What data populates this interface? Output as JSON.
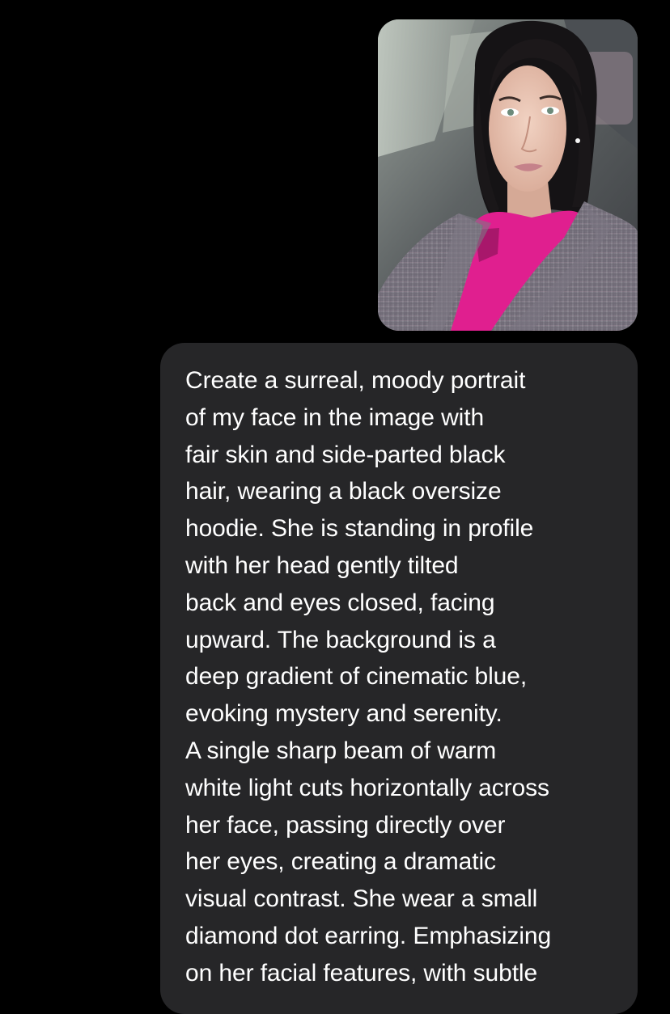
{
  "conversation": {
    "attachment": {
      "type": "photo",
      "icon": "portrait-photo"
    },
    "message": {
      "lines": [
        "Create a surreal, moody portrait",
        "of my face in the image with",
        "fair skin and side-parted black",
        "hair, wearing a black oversize",
        "hoodie. She is standing in profile",
        "with her head gently tilted",
        "back and eyes closed, facing",
        "upward. The background is a",
        "deep gradient of cinematic blue,",
        "evoking mystery and serenity.",
        "A single sharp beam of warm",
        "white light cuts horizontally across",
        "her face, passing directly over",
        "her eyes, creating a dramatic",
        "visual contrast. She wear a small",
        "diamond dot earring. Emphasizing",
        "on her facial features, with subtle"
      ]
    }
  },
  "colors": {
    "background": "#000000",
    "bubble": "#262628",
    "text": "#ffffff"
  }
}
